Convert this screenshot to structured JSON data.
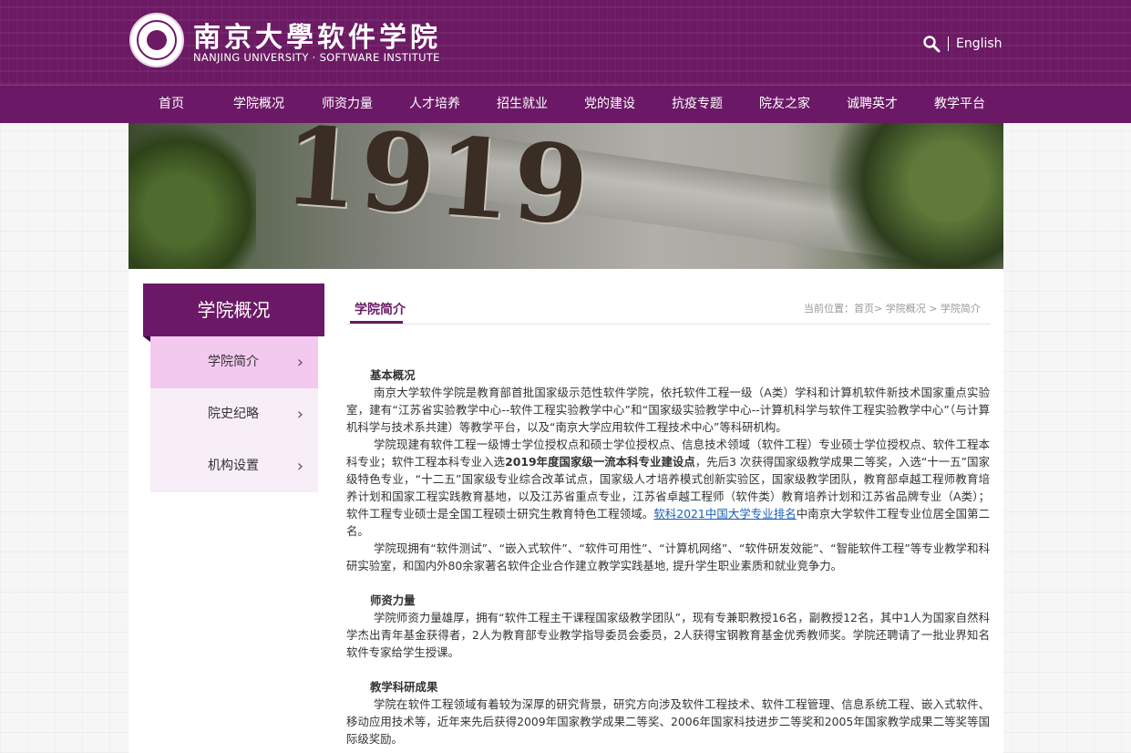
{
  "header": {
    "logo_cn": "南京大學软件学院",
    "logo_en": "NANJING UNIVERSITY · SOFTWARE INSTITUTE",
    "lang_link": "English"
  },
  "nav": {
    "items": [
      "首页",
      "学院概况",
      "师资力量",
      "人才培养",
      "招生就业",
      "党的建设",
      "抗疫专题",
      "院友之家",
      "诚聘英才",
      "教学平台"
    ]
  },
  "banner": {
    "year": "1919"
  },
  "sidebar": {
    "title": "学院概况",
    "items": [
      {
        "label": "学院简介",
        "active": true
      },
      {
        "label": "院史纪略",
        "active": false
      },
      {
        "label": "机构设置",
        "active": false
      }
    ]
  },
  "main": {
    "tab": "学院简介",
    "breadcrumb": "当前位置：首页> 学院概况 > 学院简介",
    "sections": [
      {
        "heading": "基本概况",
        "p1": "南京大学软件学院是教育部首批国家级示范性软件学院，依托软件工程一级（A类）学科和计算机软件新技术国家重点实验室，建有“江苏省实验教学中心--软件工程实验教学中心”和“国家级实验教学中心--计算机科学与软件工程实验教学中心”（与计算机科学与技术系共建）等教学平台，以及“南京大学应用软件工程技术中心”等科研机构。",
        "p2_a": "学院现建有软件工程一级博士学位授权点和硕士学位授权点、信息技术领域（软件工程）专业硕士学位授权点、软件工程本科专业；软件工程本科专业入选",
        "p2_bold": "2019年度国家级一流本科专业建设点",
        "p2_b": "，先后3 次获得国家级教学成果二等奖，入选“十一五”国家级特色专业，“十二五”国家级专业综合改革试点，国家级人才培养模式创新实验区，国家级教学团队，教育部卓越工程师教育培养计划和国家工程实践教育基地，以及江苏省重点专业，江苏省卓越工程师（软件类）教育培养计划和江苏省品牌专业（A类）；软件工程专业硕士是全国工程硕士研究生教育特色工程领域。",
        "p2_link": "软科2021中国大学专业排名",
        "p2_c": "中南京大学软件工程专业位居全国第二名。",
        "p3": "学院现拥有“软件测试”、“嵌入式软件”、“软件可用性”、“计算机网络”、“软件研发效能”、“智能软件工程”等专业教学和科研实验室，和国内外80余家著名软件企业合作建立教学实践基地, 提升学生职业素质和就业竞争力。"
      },
      {
        "heading": "师资力量",
        "p1": "学院师资力量雄厚，拥有“软件工程主干课程国家级教学团队”，现有专兼职教授16名，副教授12名，其中1人为国家自然科学杰出青年基金获得者，2人为教育部专业教学指导委员会委员，2人获得宝钢教育基金优秀教师奖。学院还聘请了一批业界知名软件专家给学生授课。"
      },
      {
        "heading": "教学科研成果",
        "p1": "学院在软件工程领域有着较为深厚的研究背景，研究方向涉及软件工程技术、软件工程管理、信息系统工程、嵌入式软件、移动应用技术等，近年来先后获得2009年国家教学成果二等奖、2006年国家科技进步二等奖和2005年国家教学成果二等奖等国际级奖励。"
      }
    ]
  },
  "colors": {
    "primary": "#6b1966",
    "active_side": "#f3c9ef",
    "side_bg": "#f8eef7",
    "link": "#1a5fb4"
  }
}
